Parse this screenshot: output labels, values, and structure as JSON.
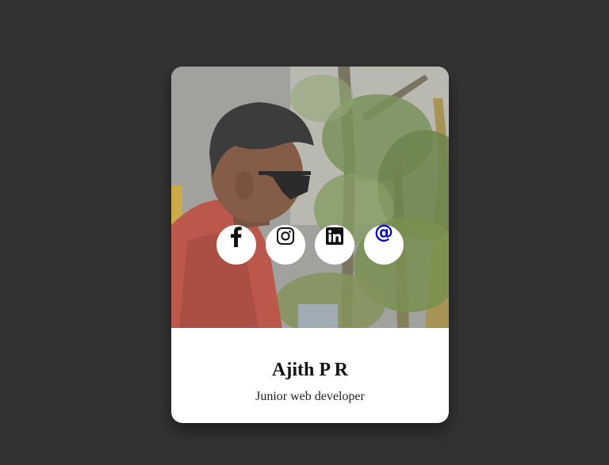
{
  "profile": {
    "name": "Ajith P R",
    "role": "Junior web developer"
  },
  "socials": [
    {
      "icon": "facebook-icon"
    },
    {
      "icon": "instagram-icon"
    },
    {
      "icon": "linkedin-icon"
    },
    {
      "icon": "at-email-icon",
      "glyph": "@",
      "color": "#0000cc"
    }
  ],
  "colors": {
    "background": "#333333",
    "card": "#ffffff",
    "email_accent": "#0000cc"
  }
}
